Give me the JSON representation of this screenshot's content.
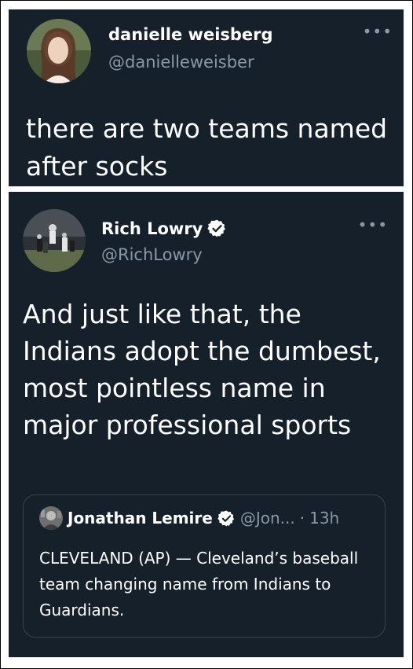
{
  "tweets": [
    {
      "display_name": "danielle weisberg",
      "handle": "@danielleweisber",
      "text": "there are two teams named after socks",
      "more_icon": "more-horizontal-icon"
    },
    {
      "display_name": "Rich Lowry",
      "handle": "@RichLowry",
      "verified": true,
      "text": "And just like that, the Indians adopt the dumbest, most pointless name in major professional sports",
      "more_icon": "more-horizontal-icon",
      "quoted_tweet": {
        "display_name": "Jonathan Lemire",
        "verified": true,
        "handle_truncated": "@Jon...",
        "separator": "·",
        "time": "13h",
        "text": "CLEVELAND (AP) — Cleveland’s baseball team changing name from Indians to Guardians."
      }
    }
  ],
  "colors": {
    "background": "#15202b",
    "secondary_text": "#8b98a5",
    "border": "#38444d",
    "verified_badge": "#ffffff"
  }
}
